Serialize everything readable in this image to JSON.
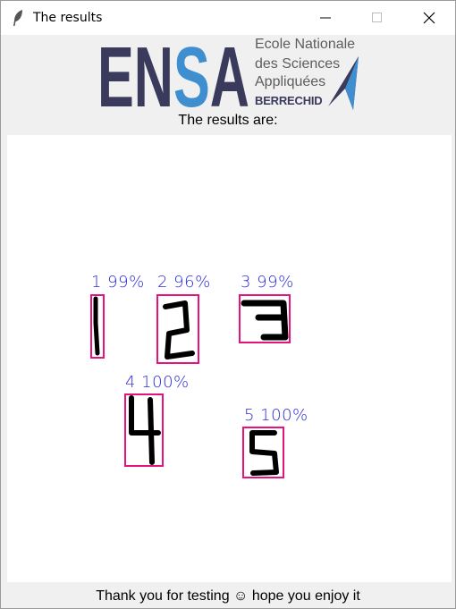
{
  "window": {
    "title": "The results",
    "icons": {
      "app": "feather-icon",
      "minimize": "minimize-icon",
      "maximize": "maximize-icon",
      "close": "close-icon"
    }
  },
  "logo": {
    "wordmark": "ENSA",
    "line1": "Ecole Nationale",
    "line2": "des Sciences",
    "line3": "Appliquées",
    "city": "BERRECHID",
    "colors": {
      "dark": "#3a3a5c",
      "blue": "#3f8ed0",
      "gray": "#5d5d5d"
    }
  },
  "heading": "The results are:",
  "detections": [
    {
      "label": "1  99%",
      "digit": "1",
      "confidence": 99
    },
    {
      "label": "2  96%",
      "digit": "2",
      "confidence": 96
    },
    {
      "label": "3  99%",
      "digit": "3",
      "confidence": 99
    },
    {
      "label": "4  100%",
      "digit": "4",
      "confidence": 100
    },
    {
      "label": "5  100%",
      "digit": "5",
      "confidence": 100
    }
  ],
  "colors": {
    "box": "#e6137a",
    "label": "#2b2bd8"
  },
  "footer": "Thank you for testing ☺ hope you enjoy it"
}
